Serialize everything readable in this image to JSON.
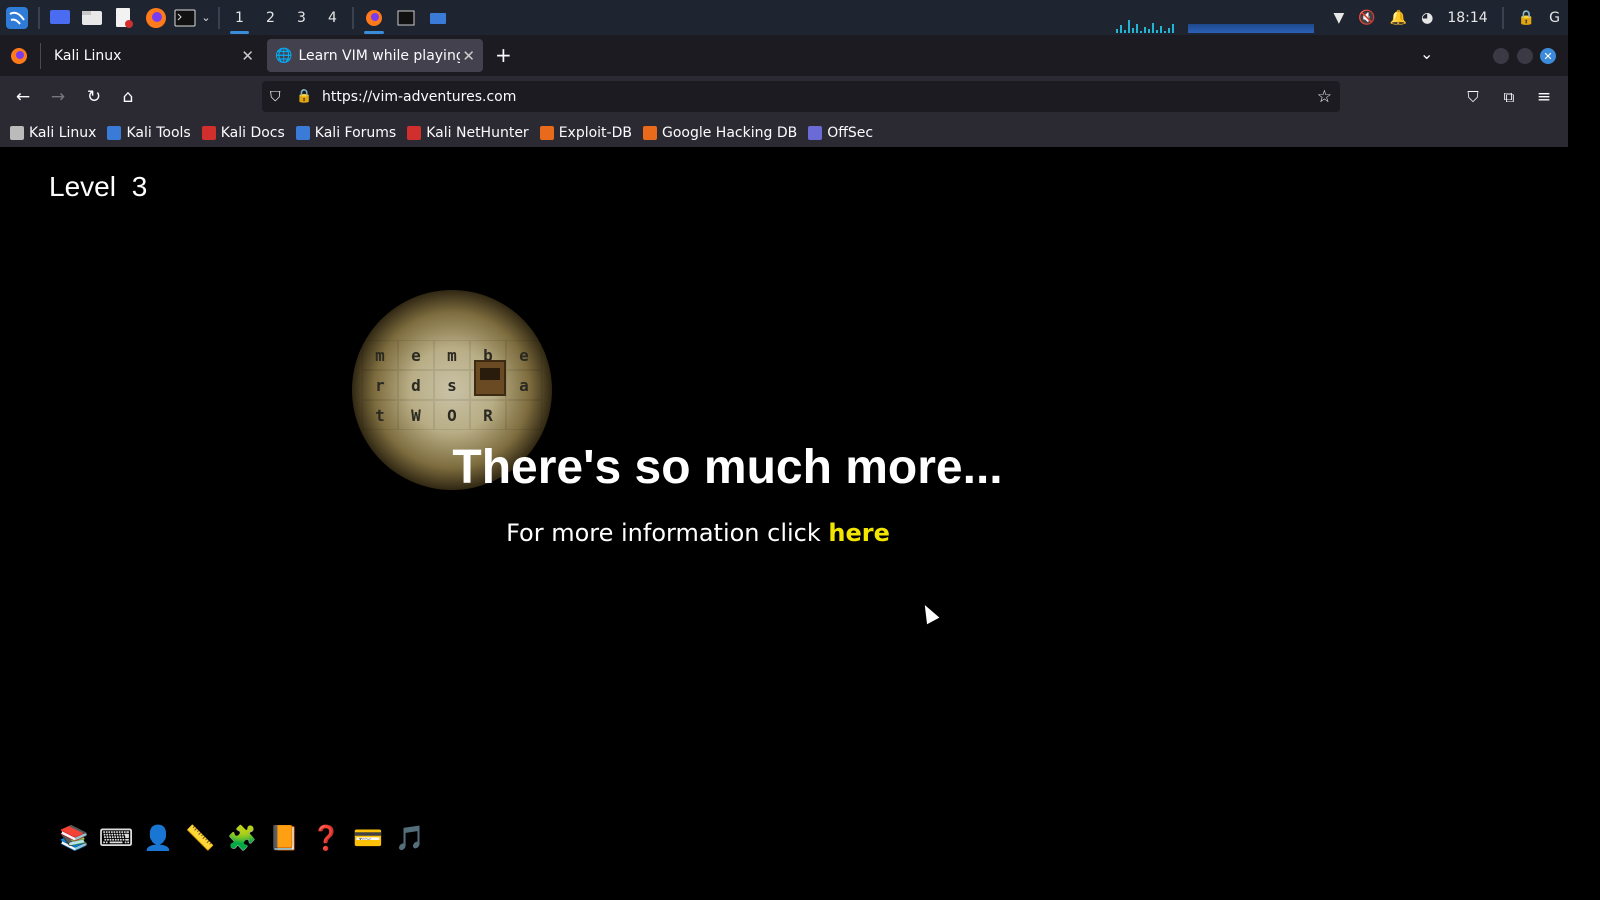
{
  "taskbar": {
    "workspaces": [
      "1",
      "2",
      "3",
      "4"
    ],
    "active_workspace": "1",
    "clock": "18:14"
  },
  "tabs": [
    {
      "label": "Kali Linux",
      "active": false
    },
    {
      "label": "Learn VIM while playing a",
      "active": true
    }
  ],
  "navbar": {
    "url": "https://vim-adventures.com"
  },
  "bookmarks": [
    {
      "label": "Kali Linux",
      "color": "#bbbbbb"
    },
    {
      "label": "Kali Tools",
      "color": "#3b7bd8"
    },
    {
      "label": "Kali Docs",
      "color": "#d12e2e"
    },
    {
      "label": "Kali Forums",
      "color": "#3b7bd8"
    },
    {
      "label": "Kali NetHunter",
      "color": "#d12e2e"
    },
    {
      "label": "Exploit-DB",
      "color": "#e86a1a"
    },
    {
      "label": "Google Hacking DB",
      "color": "#e86a1a"
    },
    {
      "label": "OffSec",
      "color": "#6b6bd8"
    }
  ],
  "game": {
    "level_label": "Level",
    "level_number": "3",
    "grid_letters": [
      "m",
      "e",
      "m",
      "b",
      "e",
      "r",
      "d",
      "s",
      "",
      "a",
      "t",
      "W",
      "O",
      "R",
      ""
    ],
    "headline": "There's so much more...",
    "info_text": "For more information click",
    "info_link": "here",
    "accent_color": "#f2e600"
  },
  "tools": [
    {
      "name": "books-icon",
      "glyph": "📚"
    },
    {
      "name": "keyboard-icon",
      "glyph": "⌨"
    },
    {
      "name": "character-icon",
      "glyph": "👤"
    },
    {
      "name": "ruler-icon",
      "glyph": "📏"
    },
    {
      "name": "puzzle-icon",
      "glyph": "🧩"
    },
    {
      "name": "book-icon",
      "glyph": "📙"
    },
    {
      "name": "help-icon",
      "glyph": "❓"
    },
    {
      "name": "card-icon",
      "glyph": "💳"
    },
    {
      "name": "music-icon",
      "glyph": "🎵"
    }
  ]
}
